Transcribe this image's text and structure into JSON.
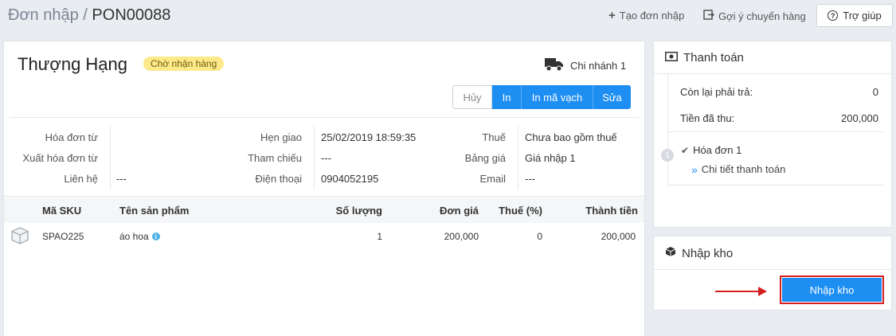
{
  "header": {
    "title_prefix": "Đơn nhập",
    "title_sep": "/",
    "order_code": "PON00088",
    "create_order": "Tạo đơn nhập",
    "suggest_transfer": "Gợi ý chuyển hàng",
    "help": "Trợ giúp"
  },
  "order": {
    "supplier": "Thượng Hạng",
    "status": "Chờ nhận hàng",
    "branch": "Chi nhánh 1",
    "status_color": "#fde98a"
  },
  "actions": {
    "cancel": "Hủy",
    "print": "In",
    "print_barcode": "In mã vạch",
    "edit": "Sửa"
  },
  "info": {
    "invoice_from_label": "Hóa đơn từ",
    "invoice_from_value": "",
    "export_invoice_label": "Xuất hóa đơn từ",
    "export_invoice_value": "",
    "contact_label": "Liên hệ",
    "contact_value": "---",
    "due_label": "Hẹn giao",
    "due_value": "25/02/2019 18:59:35",
    "reference_label": "Tham chiếu",
    "reference_value": "---",
    "phone_label": "Điện thoại",
    "phone_value": "0904052195",
    "tax_label": "Thuế",
    "tax_value": "Chưa bao gồm thuế",
    "pricelist_label": "Bảng giá",
    "pricelist_value": "Giá nhập 1",
    "email_label": "Email",
    "email_value": "---"
  },
  "table": {
    "headers": {
      "sku": "Mã SKU",
      "name": "Tên sản phẩm",
      "qty": "Số lượng",
      "price": "Đơn giá",
      "tax": "Thuế (%)",
      "total": "Thành tiền"
    },
    "rows": [
      {
        "sku": "SPAO225",
        "name": "áo hoa",
        "qty": "1",
        "price": "200,000",
        "tax": "0",
        "total": "200,000"
      }
    ]
  },
  "payment": {
    "title": "Thanh toán",
    "remaining_label": "Còn lại phải trả:",
    "remaining_value": "0",
    "paid_label": "Tiền đã thu:",
    "paid_value": "200,000",
    "step_number": "1",
    "invoice_label": "Hóa đơn 1",
    "details_link": "Chi tiết thanh toán"
  },
  "warehouse": {
    "title": "Nhập kho",
    "button": "Nhập kho"
  },
  "colors": {
    "accent": "#1d8ef2",
    "highlight": "#d62020"
  }
}
